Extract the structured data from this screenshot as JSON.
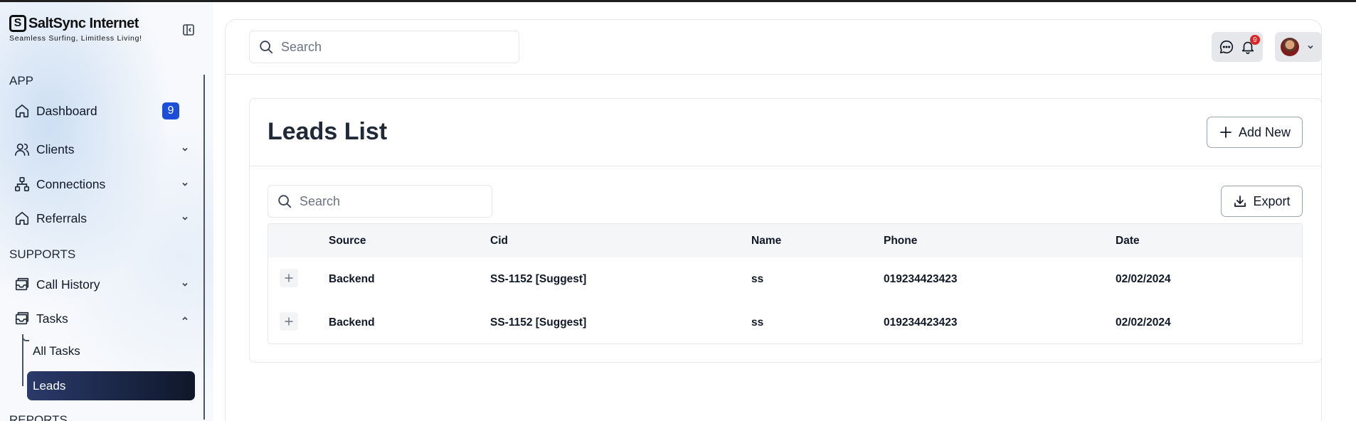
{
  "brand": {
    "name": "SaltSync Internet",
    "tagline": "Seamless Surfing, Limitless Living!"
  },
  "sidebar": {
    "sections": [
      {
        "label": "APP"
      },
      {
        "label": "SUPPORTS"
      },
      {
        "label": "REPORTS"
      }
    ],
    "items": [
      {
        "label": "Dashboard",
        "icon": "home-icon",
        "badge": "9"
      },
      {
        "label": "Clients",
        "icon": "users-icon"
      },
      {
        "label": "Connections",
        "icon": "network-icon"
      },
      {
        "label": "Referrals",
        "icon": "home-icon"
      },
      {
        "label": "Call History",
        "icon": "inbox-icon"
      },
      {
        "label": "Tasks",
        "icon": "inbox-icon",
        "expanded": true
      }
    ],
    "task_subitems": [
      {
        "label": "All Tasks"
      },
      {
        "label": "Leads",
        "active": true
      }
    ]
  },
  "header": {
    "search_placeholder": "Search",
    "notification_count": "9"
  },
  "page": {
    "title": "Leads List",
    "add_button": "Add New",
    "export_button": "Export",
    "search_placeholder": "Search"
  },
  "table": {
    "columns": [
      "Source",
      "Cid",
      "Name",
      "Phone",
      "Date"
    ],
    "rows": [
      {
        "source": "Backend",
        "cid": "SS-1152 [Suggest]",
        "name": "ss",
        "phone": "019234423423",
        "date": "02/02/2024"
      },
      {
        "source": "Backend",
        "cid": "SS-1152 [Suggest]",
        "name": "ss",
        "phone": "019234423423",
        "date": "02/02/2024"
      }
    ]
  },
  "colors": {
    "accent": "#1d4ed8",
    "active_nav_start": "#2a3a6a",
    "active_nav_end": "#0f172a",
    "notification": "#dc2626"
  }
}
